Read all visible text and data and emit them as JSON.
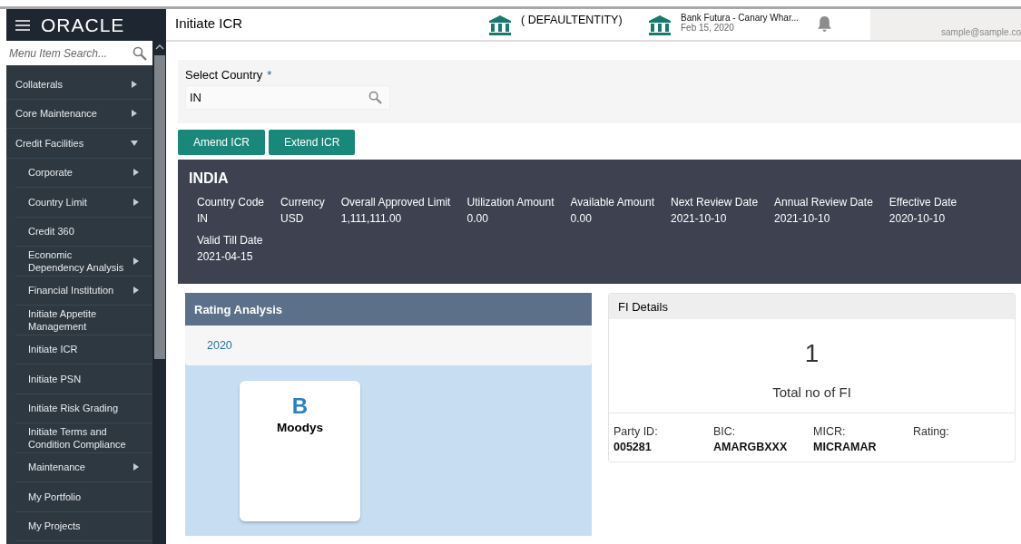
{
  "brand": {
    "logo": "ORACLE"
  },
  "menu_search": {
    "placeholder": "Menu Item Search..."
  },
  "sidebar": {
    "items": [
      {
        "label": "Collaterals",
        "kind": "group",
        "expanded": false
      },
      {
        "label": "Core Maintenance",
        "kind": "group",
        "expanded": false
      },
      {
        "label": "Credit Facilities",
        "kind": "group",
        "expanded": true,
        "children": [
          {
            "label": "Corporate",
            "kind": "group",
            "expanded": false
          },
          {
            "label": "Country Limit",
            "kind": "group",
            "expanded": false
          },
          {
            "label": "Credit 360",
            "kind": "page"
          },
          {
            "label": "Economic Dependency Analysis",
            "kind": "group",
            "expanded": false
          },
          {
            "label": "Financial Institution",
            "kind": "group",
            "expanded": false
          },
          {
            "label": "Initiate Appetite Management",
            "kind": "page"
          },
          {
            "label": "Initiate ICR",
            "kind": "page"
          },
          {
            "label": "Initiate PSN",
            "kind": "page"
          },
          {
            "label": "Initiate Risk Grading",
            "kind": "page"
          },
          {
            "label": "Initiate Terms and Condition Compliance",
            "kind": "page"
          },
          {
            "label": "Maintenance",
            "kind": "group",
            "expanded": false
          },
          {
            "label": "My Portfolio",
            "kind": "page"
          },
          {
            "label": "My Projects",
            "kind": "page"
          }
        ]
      }
    ]
  },
  "header": {
    "title": "Initiate ICR",
    "entity": "( DEFAULTENTITY)",
    "branch": "Bank Futura - Canary Whar...",
    "date": "Feb 15, 2020",
    "user_email": "sample@sample.co"
  },
  "country_field": {
    "label": "Select Country",
    "required_mark": "*",
    "value": "IN"
  },
  "buttons": [
    "Amend ICR",
    "Extend ICR"
  ],
  "country_summary": {
    "name": "INDIA",
    "fields": [
      {
        "label": "Country Code",
        "value": "IN"
      },
      {
        "label": "Currency",
        "value": "USD"
      },
      {
        "label": "Overall Approved Limit",
        "value": "1,111,111.00"
      },
      {
        "label": "Utilization Amount",
        "value": "0.00"
      },
      {
        "label": "Available Amount",
        "value": "0.00"
      },
      {
        "label": "Next Review Date",
        "value": "2021-10-10"
      },
      {
        "label": "Annual Review Date",
        "value": "2021-10-10"
      },
      {
        "label": "Effective Date",
        "value": "2020-10-10"
      },
      {
        "label": "Valid Till Date",
        "value": "2021-04-15"
      }
    ]
  },
  "rating_analysis": {
    "title": "Rating Analysis",
    "year": "2020",
    "ratings": [
      {
        "grade": "B",
        "agency": "Moodys"
      }
    ]
  },
  "fi_details": {
    "title": "FI Details",
    "count": "1",
    "count_label": "Total no of FI",
    "fields": [
      {
        "label": "Party ID:",
        "value": "005281"
      },
      {
        "label": "BIC:",
        "value": "AMARGBXXX"
      },
      {
        "label": "MICR:",
        "value": "MICRAMAR"
      },
      {
        "label": "Rating:"
      }
    ]
  }
}
